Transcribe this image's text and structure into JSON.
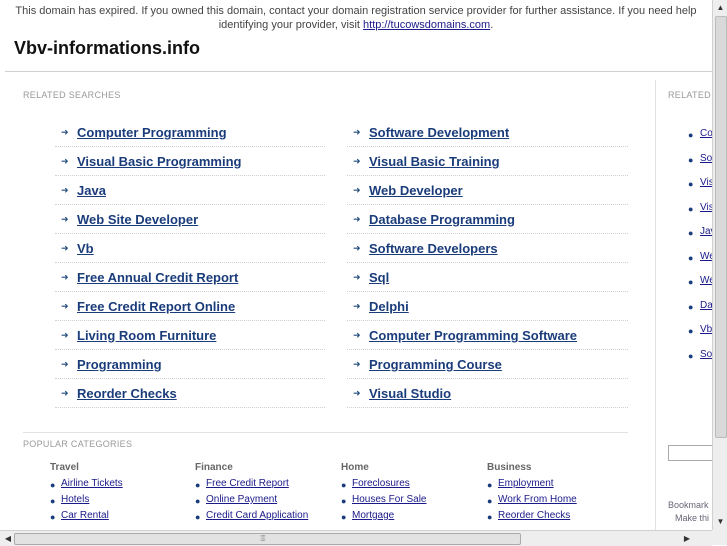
{
  "notice": {
    "text": "This domain has expired. If you owned this domain, contact your domain registration service provider for further assistance. If you need help identifying your provider, visit ",
    "link": "http://tucowsdomains.com",
    "end": "."
  },
  "site": {
    "title": "Vbv-informations.info"
  },
  "related": {
    "heading": "RELATED SEARCHES",
    "rows": [
      [
        "Computer Programming",
        "Software Development"
      ],
      [
        "Visual Basic Programming",
        "Visual Basic Training"
      ],
      [
        "Java",
        "Web Developer"
      ],
      [
        "Web Site Developer",
        "Database Programming"
      ],
      [
        "Vb",
        "Software Developers"
      ],
      [
        "Free Annual Credit Report",
        "Sql"
      ],
      [
        "Free Credit Report Online",
        "Delphi"
      ],
      [
        "Living Room Furniture",
        "Computer Programming Software"
      ],
      [
        "Programming",
        "Programming Course"
      ],
      [
        "Reorder Checks",
        "Visual Studio"
      ]
    ],
    "arrow_glyph": "➜"
  },
  "popular": {
    "heading": "POPULAR CATEGORIES",
    "categories": [
      {
        "title": "Travel",
        "items": [
          "Airline Tickets",
          "Hotels",
          "Car Rental"
        ]
      },
      {
        "title": "Finance",
        "items": [
          "Free Credit Report",
          "Online Payment",
          "Credit Card Application"
        ]
      },
      {
        "title": "Home",
        "items": [
          "Foreclosures",
          "Houses For Sale",
          "Mortgage"
        ]
      },
      {
        "title": "Business",
        "items": [
          "Employment",
          "Work From Home",
          "Reorder Checks"
        ]
      }
    ]
  },
  "right_column": {
    "heading": "RELATED",
    "items": [
      "Co",
      "So",
      "Vis",
      "Vis",
      "Jav",
      "We",
      "We",
      "Da",
      "Vb",
      "So"
    ],
    "bookmark_1": "Bookmark",
    "bookmark_2": "Make thi"
  },
  "colors": {
    "link": "#1a3c7a",
    "heading": "#999999",
    "rule": "#cfcfcf"
  },
  "icons": {
    "bullet": "bullet-icon",
    "arrow": "arrow-right-icon"
  }
}
